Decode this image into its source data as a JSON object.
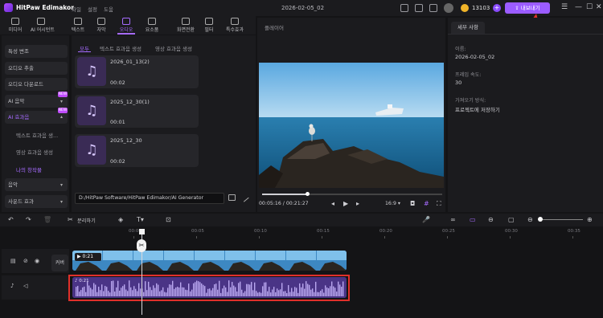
{
  "app": {
    "name": "HitPaw Edimakor",
    "menus": [
      "파일",
      "설정",
      "도움"
    ],
    "doc_title": "2026-02-05_02",
    "credits": "13103",
    "export_label": "내보내기"
  },
  "tools": [
    "미디어",
    "AI 어시턴트",
    "텍스트",
    "자막",
    "오디오",
    "요소품",
    "화면전환",
    "필터",
    "특수효과"
  ],
  "sidebar": {
    "items": [
      {
        "label": "특성 변조"
      },
      {
        "label": "오디오 추출"
      },
      {
        "label": "오디오 다운로드"
      },
      {
        "label": "AI 음악",
        "badge": "NEW"
      },
      {
        "label": "AI 효과음",
        "badge": "NEW"
      }
    ],
    "subs": [
      "텍스트 효과음 생...",
      "영상 효과음 생성",
      "나의 창작물"
    ],
    "bottom": [
      "음악",
      "사운드 효과"
    ]
  },
  "audio_panel": {
    "subtabs": [
      "모두",
      "텍스트 효과음 생성",
      "영상 효과음 생성"
    ],
    "cards": [
      {
        "title": "2026_01_13(2)",
        "duration": "00:02"
      },
      {
        "title": "2025_12_30(1)",
        "duration": "00:01"
      },
      {
        "title": "2025_12_30",
        "duration": "00:02"
      }
    ],
    "path": "D:/HitPaw Software/HitPaw Edimakor/AI Generator"
  },
  "player": {
    "title": "플레이어",
    "current": "00:05:16",
    "total": "00:21:27",
    "ratio": "16:9",
    "progress": 0.25
  },
  "properties": {
    "tab": "세부 사항",
    "fields": [
      {
        "label": "이름:",
        "value": "2026-02-05_02"
      },
      {
        "label": "프레임 속도:",
        "value": "30"
      },
      {
        "label": "가져오기 방식:",
        "value": "프로젝트에 저장하기"
      }
    ]
  },
  "timeline": {
    "split_label": "분리하기",
    "ruler": [
      "00:00",
      "00:05",
      "00:10",
      "00:15",
      "00:20",
      "00:25",
      "00:30",
      "00:35",
      "00:40"
    ],
    "cover_label": "커버",
    "video_clip_duration": "0:21",
    "audio_clip_duration": "0:21"
  }
}
